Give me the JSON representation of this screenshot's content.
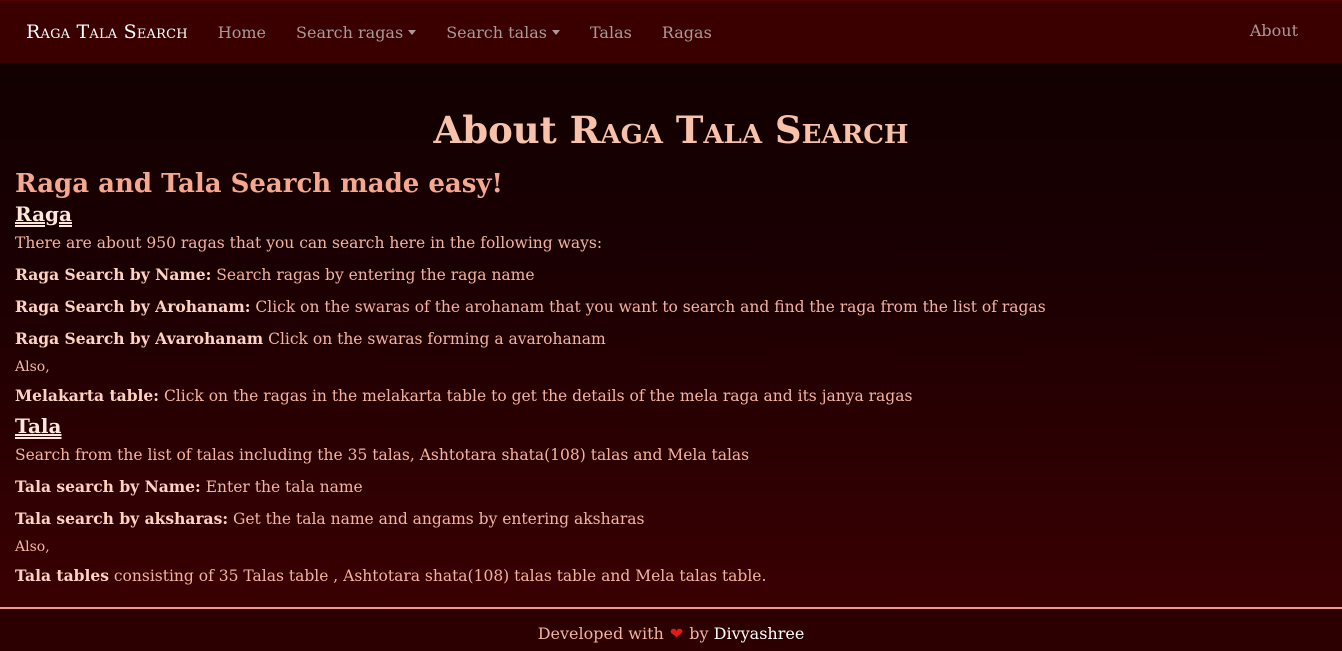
{
  "navbar": {
    "brand": "Raga Tala Search",
    "items": [
      {
        "label": "Home",
        "dropdown": false
      },
      {
        "label": "Search ragas",
        "dropdown": true
      },
      {
        "label": "Search talas",
        "dropdown": true
      },
      {
        "label": "Talas",
        "dropdown": false
      },
      {
        "label": "Ragas",
        "dropdown": false
      }
    ],
    "about": "About"
  },
  "page": {
    "title_prefix": "About",
    "title_brand": "Raga Tala Search",
    "tagline": "Raga and Tala Search made easy!"
  },
  "raga": {
    "heading": "Raga",
    "intro": "There are about 950 ragas that you can search here in the following ways:",
    "items": [
      {
        "label": "Raga Search by Name:",
        "text": " Search ragas by entering the raga name"
      },
      {
        "label": "Raga Search by Arohanam:",
        "text": " Click on the swaras of the arohanam that you want to search and find the raga from the list of ragas"
      },
      {
        "label": "Raga Search by Avarohanam",
        "text": " Click on the swaras forming a avarohanam"
      }
    ],
    "also": "Also,",
    "extra": {
      "label": "Melakarta table:",
      "text": " Click on the ragas in the melakarta table to get the details of the mela raga and its janya ragas"
    }
  },
  "tala": {
    "heading": "Tala",
    "intro": "Search from the list of talas including the 35 talas, Ashtotara shata(108) talas and Mela talas",
    "items": [
      {
        "label": "Tala search by Name:",
        "text": " Enter the tala name"
      },
      {
        "label": "Tala search by aksharas:",
        "text": " Get the tala name and angams by entering aksharas"
      }
    ],
    "also": "Also,",
    "extra": {
      "label": "Tala tables",
      "text": " consisting of 35 Talas table , Ashtotara shata(108) talas table and Mela talas table."
    }
  },
  "footer": {
    "prefix": "Developed with",
    "heart": "❤",
    "by": "by",
    "author": "Divyashree"
  },
  "colors": {
    "navbar_bg": "#3a0000",
    "text": "#f4b3a0",
    "heart": "#e61818"
  }
}
